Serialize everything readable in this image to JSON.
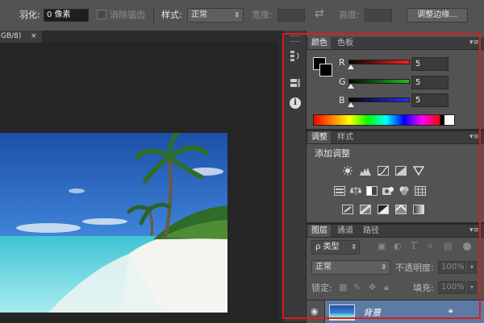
{
  "options_bar": {
    "feather_label": "羽化:",
    "feather_value": "0 像素",
    "antialias_label": "消除锯齿",
    "style_label": "样式:",
    "style_value": "正常",
    "width_label": "宽度:",
    "height_label": "高度:",
    "refine_edge_button": "调整边缘..."
  },
  "document_tab": {
    "title": "GB/8)",
    "close": "×"
  },
  "color_panel": {
    "tabs": [
      "颜色",
      "色板"
    ],
    "channels": [
      {
        "label": "R",
        "value": "5",
        "color": "#ff2020"
      },
      {
        "label": "G",
        "value": "5",
        "color": "#20c020"
      },
      {
        "label": "B",
        "value": "5",
        "color": "#2030ff"
      }
    ]
  },
  "adjustments_panel": {
    "tabs": [
      "调整",
      "样式"
    ],
    "heading": "添加调整",
    "icons_row1": [
      "brightness-icon",
      "levels-icon",
      "curves-icon",
      "exposure-icon",
      "vibrance-icon"
    ],
    "icons_row2": [
      "hue-saturation-icon",
      "color-balance-icon",
      "black-white-icon",
      "photo-filter-icon",
      "channel-mixer-icon",
      "color-lookup-icon"
    ],
    "icons_row3": [
      "invert-icon",
      "posterize-icon",
      "threshold-icon",
      "selective-color-icon",
      "gradient-map-icon"
    ]
  },
  "layers_panel": {
    "tabs": [
      "图层",
      "通道",
      "路径"
    ],
    "filter_kind": "ρ 类型",
    "blend_mode": "正常",
    "opacity_label": "不透明度:",
    "opacity_value": "100%",
    "lock_label": "锁定:",
    "fill_label": "填充:",
    "fill_value": "100%",
    "layers": [
      {
        "name": "背景",
        "visible": true,
        "locked": true
      }
    ]
  },
  "colors": {
    "highlight_frame": "#d61f1f",
    "panel_bg": "#535353"
  }
}
